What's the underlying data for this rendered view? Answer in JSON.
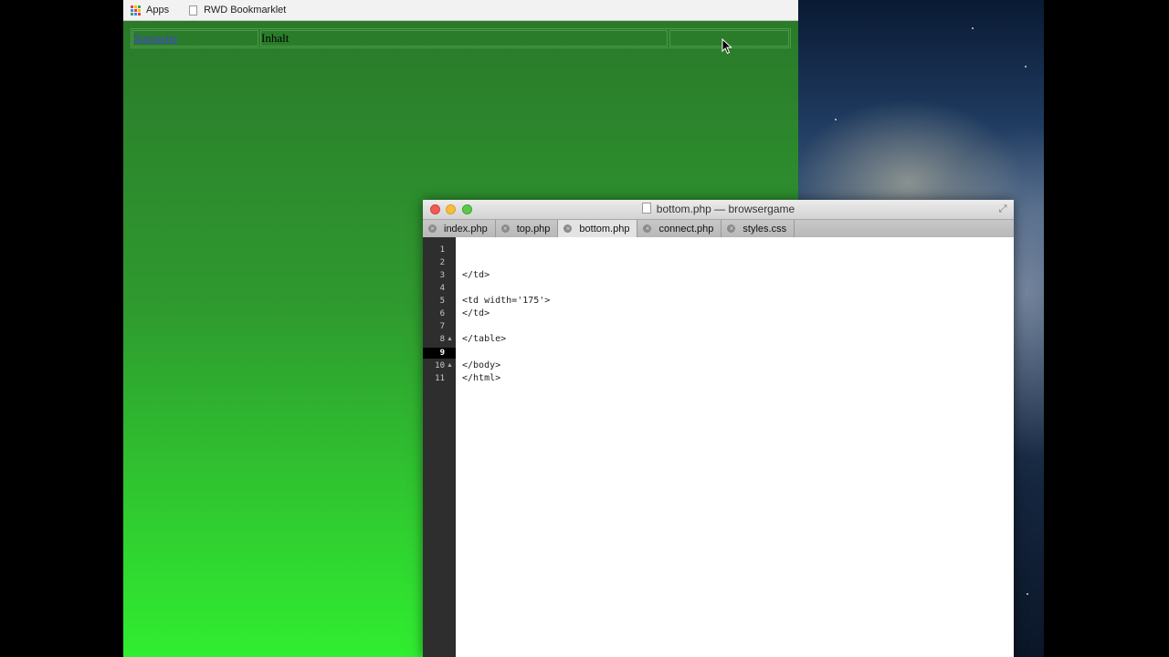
{
  "bookmarks": [
    {
      "label": "Apps",
      "icon": "apps-grid-icon"
    },
    {
      "label": "RWD Bookmarklet",
      "icon": "page-icon"
    }
  ],
  "webpage": {
    "nav_link": "Startseite",
    "content": "Inhalt"
  },
  "editor": {
    "title": "bottom.php — browsergame",
    "tabs": [
      {
        "label": "index.php",
        "active": false
      },
      {
        "label": "top.php",
        "active": false
      },
      {
        "label": "bottom.php",
        "active": true
      },
      {
        "label": "connect.php",
        "active": false
      },
      {
        "label": "styles.css",
        "active": false
      }
    ],
    "lines": [
      "1",
      "2",
      "3",
      "4",
      "5",
      "6",
      "7",
      "8",
      "9",
      "10",
      "11"
    ],
    "current_line": "9",
    "code": [
      "",
      "",
      "</td>",
      "",
      "<td width='175'>",
      "</td>",
      "",
      "</table>",
      "",
      "</body>",
      "</html>"
    ]
  },
  "colors": {
    "page_green_top": "#2a7a2a",
    "page_green_bottom": "#30ee30",
    "link": "#4444cc"
  }
}
